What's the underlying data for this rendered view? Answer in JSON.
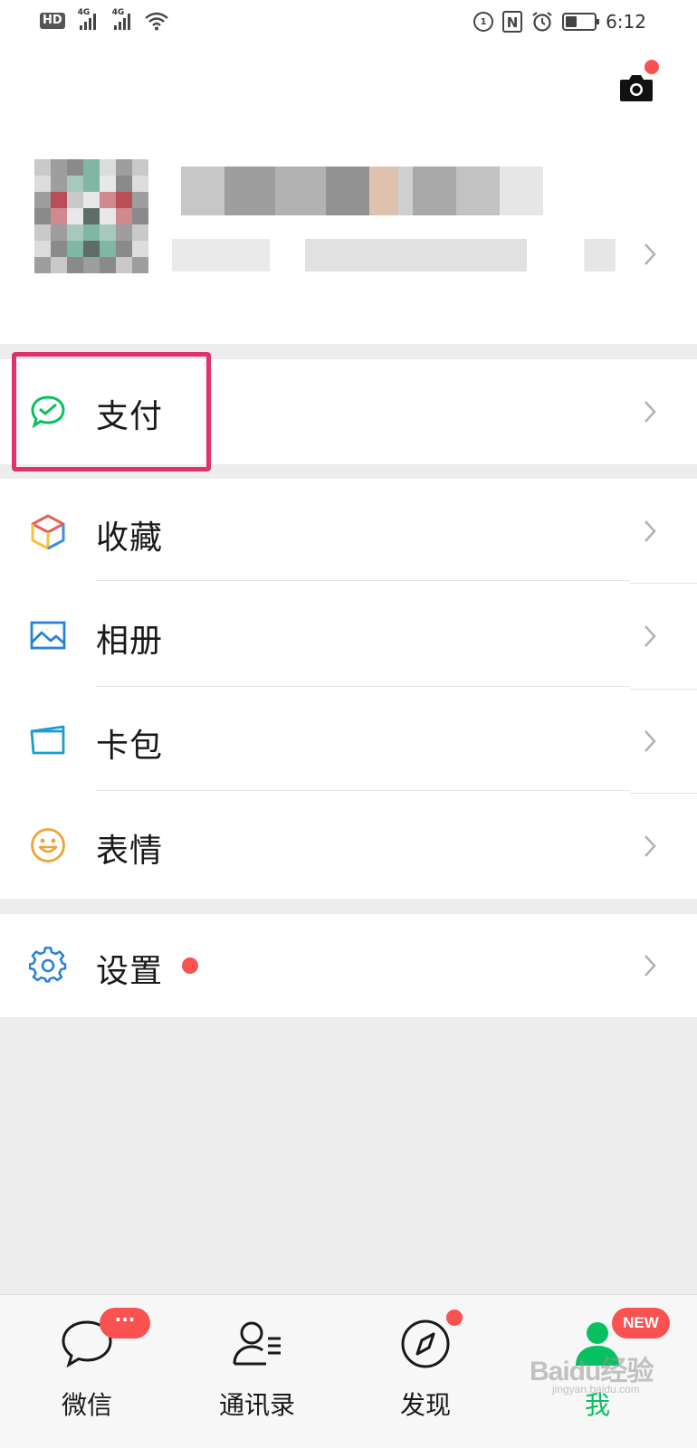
{
  "status_bar": {
    "hd_label": "HD",
    "network_1": "4G",
    "network_2": "4G",
    "nfc_label": "N",
    "time": "6:12",
    "battery_level": 0.4
  },
  "header": {
    "camera_icon": "camera-icon",
    "camera_badge": true
  },
  "menu": {
    "pay": {
      "label": "支付",
      "icon": "wechat-pay-icon",
      "color": "#07c160"
    },
    "favorites": {
      "label": "收藏",
      "icon": "favorites-cube-icon"
    },
    "album": {
      "label": "相册",
      "icon": "album-picture-icon",
      "color": "#2782d7"
    },
    "cards": {
      "label": "卡包",
      "icon": "card-wallet-icon",
      "color": "#1e9ad6"
    },
    "stickers": {
      "label": "表情",
      "icon": "smiley-face-icon",
      "color": "#f0a237"
    },
    "settings": {
      "label": "设置",
      "icon": "gear-icon",
      "color": "#2782d7",
      "badge_dot": true
    }
  },
  "tabbar": {
    "tabs": [
      {
        "label": "微信",
        "icon": "chat-bubble-icon",
        "badge": "···"
      },
      {
        "label": "通讯录",
        "icon": "contacts-icon"
      },
      {
        "label": "发现",
        "icon": "compass-icon",
        "badge_dot": true
      },
      {
        "label": "我",
        "icon": "me-person-icon",
        "badge": "NEW",
        "active": true
      }
    ],
    "active_color": "#07c160"
  },
  "watermark": {
    "text": "Baidu经验",
    "sub": "jingyan.baidu.com"
  },
  "colors": {
    "accent": "#07c160",
    "badge_red": "#fa5151",
    "highlight": "#e0306f"
  }
}
